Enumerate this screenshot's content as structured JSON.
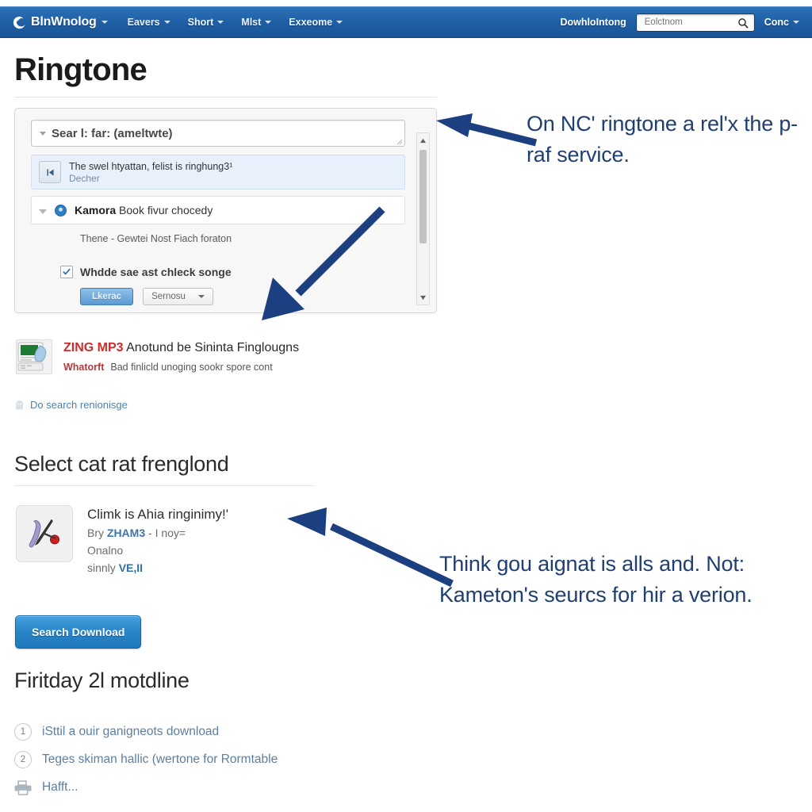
{
  "navbar": {
    "brand": "BlnWnolog",
    "brand_icon": "swirl-logo-icon",
    "menus": [
      {
        "label": "Eavers"
      },
      {
        "label": "Short"
      },
      {
        "label": "Mlst"
      },
      {
        "label": "Exxeome"
      }
    ],
    "download_link": "DowhloIntong",
    "search": {
      "value": "",
      "placeholder": "Eolctnom",
      "icon": "search-icon"
    },
    "account": "Conc",
    "bg_color": "#1f5fa4"
  },
  "page": {
    "title": "Ringtone"
  },
  "panel": {
    "search_field": {
      "value": "Sear l: far: (ameltwte)",
      "caret_icon": "chevron-down-icon",
      "grip_icon": "resize-grip-icon"
    },
    "results": [
      {
        "icon": "first-track-icon",
        "title": "The swel htyattan, felist is ringhung3¹",
        "subtitle": "Decher"
      },
      {
        "caret_icon": "chevron-down-icon",
        "dot_icon": "blue-disc-icon",
        "strong": "Kamora",
        "title": " Book fivur chocedy"
      }
    ],
    "note": "Thene - Gewtei Nost Fiach foraton",
    "checkbox": {
      "checked": true,
      "label": "Whdde sae ast chleck songe"
    },
    "actions": {
      "primary": "Lkerac",
      "select": "Sernosu",
      "select_caret": "chevron-down-icon"
    },
    "scrollbar": {
      "up_icon": "scroll-up-arrow-icon",
      "down_icon": "scroll-down-arrow-icon"
    }
  },
  "zing_result": {
    "thumb_icon": "device-screen-thumbnail-icon",
    "brand": "ZING MP3",
    "headline": "Anotund be Sininta Finglougns",
    "site": "Whatorft",
    "snippet": "Bad finlicld unoging sookr spore cont",
    "more_link": "Do search renionisge",
    "more_icon": "ghost-icon",
    "brand_color": "#cf2b2b"
  },
  "select_section": {
    "heading": "Select cat rat frenglond",
    "song": {
      "icon": "hockey-stick-puck-icon",
      "title": "Climk is Ahia ringinimy!'",
      "meta_prefix": "Bry ",
      "meta_brand": "ZHAM3",
      "meta_suffix": " - I noy=",
      "meta_line2": "Onalno",
      "meta_line3_prefix": "sinnly ",
      "meta_line3_strong": "VE,II"
    },
    "button": "Search Download"
  },
  "steps_section": {
    "heading": "Firitday 2l motdline",
    "steps": [
      {
        "num": "1",
        "text": "iSttil a ouir ganigneots download"
      },
      {
        "num": "2",
        "text": "Teges skiman hallic (wertone for Rormtable"
      }
    ],
    "footer": {
      "icon": "printer-icon",
      "text": "Hafft..."
    }
  },
  "annotations": {
    "color": "#1f3f73",
    "first": "On NC' ringtone a rel'x the p-raf service.",
    "second": "Think gou aignat is alls and. Not: Kameton's seurcs for hir a verion.",
    "arrow_1_name": "annotation-arrow-to-search-panel",
    "arrow_2_name": "annotation-arrow-to-panel-actions",
    "arrow_3_name": "annotation-arrow-to-song-item"
  }
}
